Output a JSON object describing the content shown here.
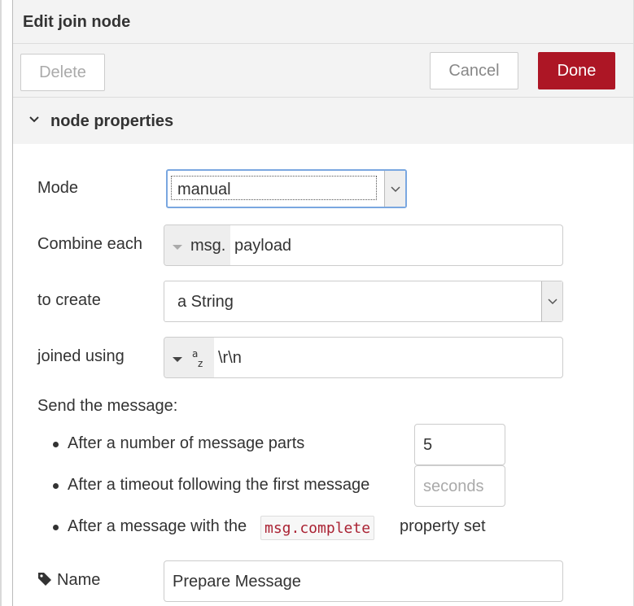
{
  "dialog": {
    "title": "Edit join node",
    "delete_label": "Delete",
    "cancel_label": "Cancel",
    "done_label": "Done"
  },
  "section": {
    "title": "node properties"
  },
  "form": {
    "mode_label": "Mode",
    "mode_value": "manual",
    "combine_label": "Combine each",
    "combine_prefix": "msg.",
    "combine_value": "payload",
    "create_label": "to create",
    "create_value": "a String",
    "joined_label": "joined using",
    "joined_type_icon": "a-z-string-type-icon",
    "joined_value": "\\r\\n",
    "send_heading": "Send the message:",
    "option_parts_label": "After a number of message parts",
    "option_parts_value": "5",
    "option_timeout_label": "After a timeout following the first message",
    "option_timeout_placeholder": "seconds",
    "option_complete_prefix": "After a message with the",
    "option_complete_code": "msg.complete",
    "option_complete_suffix": "property set",
    "name_label": "Name",
    "name_value": "Prepare Message"
  },
  "colors": {
    "done_button": "#ad1625",
    "focus_border": "#7aa7e0",
    "code_text": "#aa2233"
  }
}
